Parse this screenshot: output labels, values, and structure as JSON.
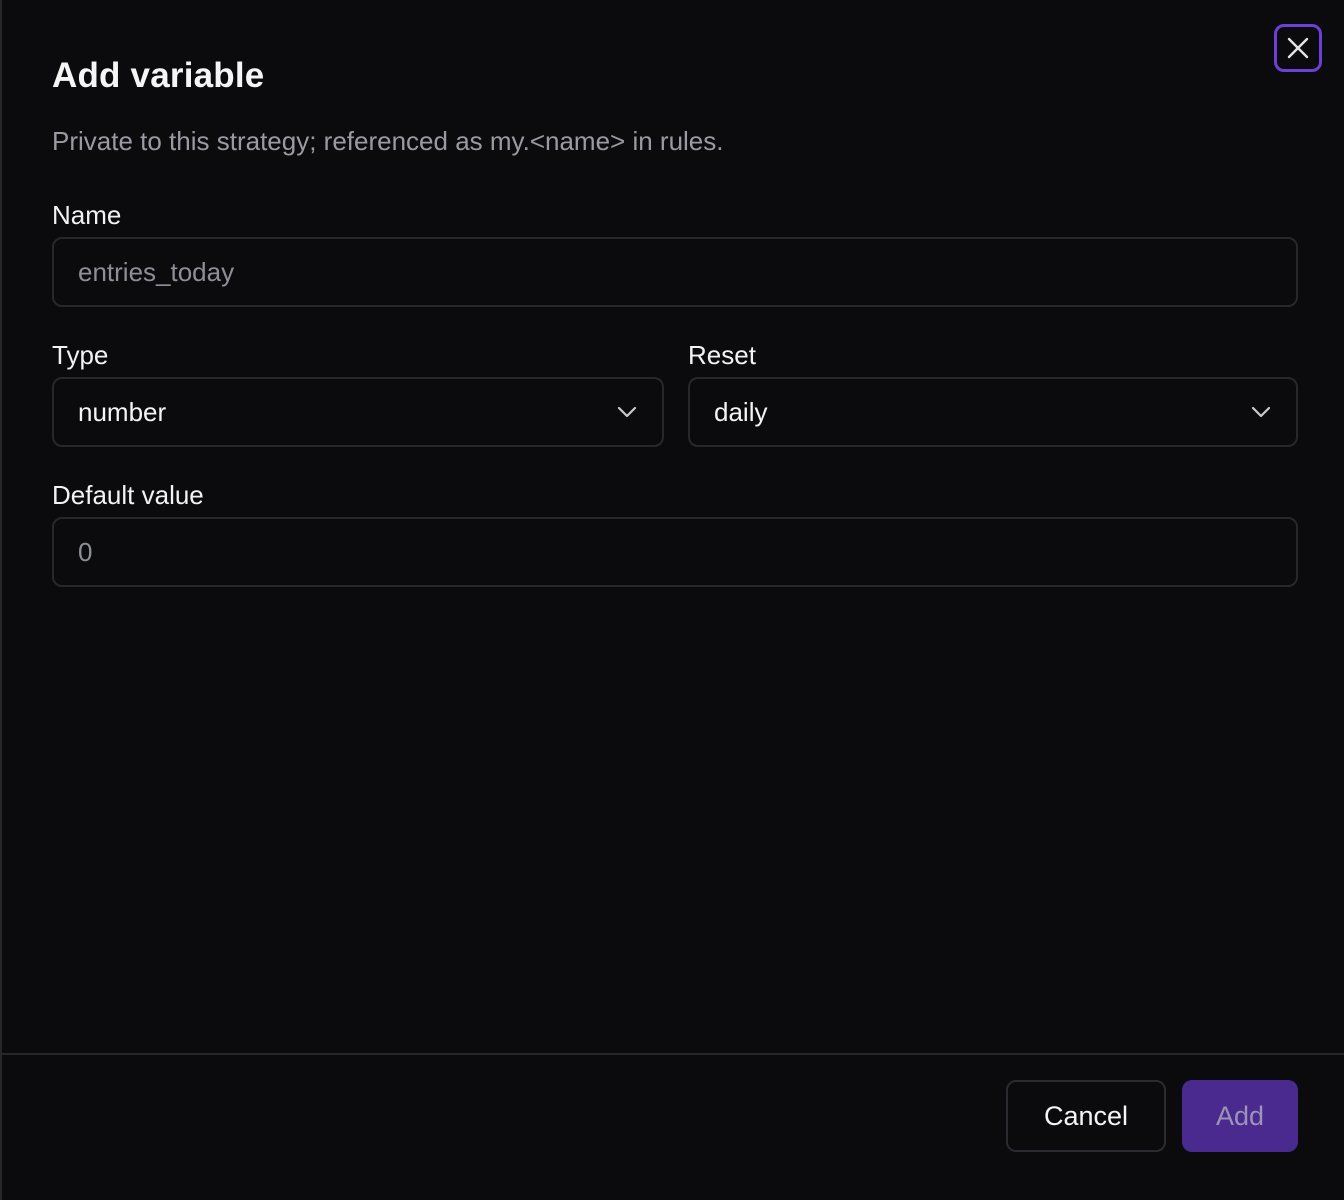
{
  "dialog": {
    "title": "Add variable",
    "subtitle": "Private to this strategy; referenced as my.<name> in rules.",
    "close_icon": "close-icon"
  },
  "form": {
    "name": {
      "label": "Name",
      "placeholder": "entries_today",
      "value": ""
    },
    "type": {
      "label": "Type",
      "selected": "number",
      "icon": "chevron-down-icon"
    },
    "reset": {
      "label": "Reset",
      "selected": "daily",
      "icon": "chevron-down-icon"
    },
    "default_value": {
      "label": "Default value",
      "placeholder": "0",
      "value": ""
    }
  },
  "footer": {
    "cancel_label": "Cancel",
    "add_label": "Add"
  },
  "colors": {
    "accent": "#6d3fd6",
    "add_button_bg": "#4a2a8f",
    "background": "#0b0b0d",
    "border": "#27272c"
  }
}
